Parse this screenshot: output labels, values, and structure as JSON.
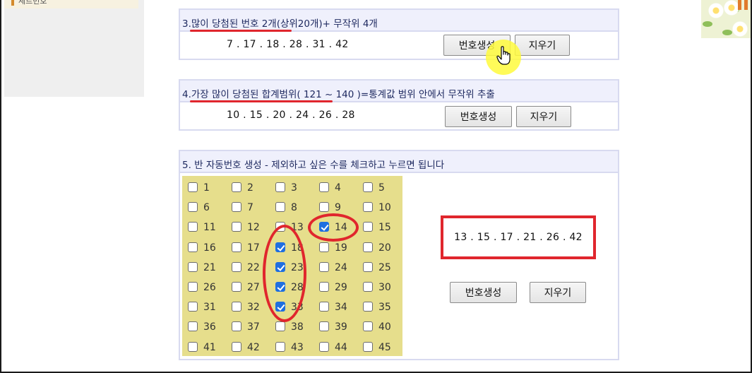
{
  "left_panel": {
    "text": "세트번호"
  },
  "sections": [
    {
      "title": "3.많이 당첨된 번호 2개(상위20개)+ 무작위 4개",
      "numbers": "7 . 17 . 18 . 28 . 31 . 42",
      "generate_label": "번호생성",
      "clear_label": "지우기"
    },
    {
      "title": "4.가장 많이 당첨된 합계범위( 121 ~ 140 )=통계값 범위 안에서 무작위 추출",
      "numbers": "10 . 15 . 20 . 24 . 26 . 28",
      "generate_label": "번호생성",
      "clear_label": "지우기"
    },
    {
      "title": "5. 반 자동번호 생성 - 제외하고 싶은 수를 체크하고 누르면 됩니다",
      "numbers": "13 . 15 . 17 . 21 . 26 . 42",
      "generate_label": "번호생성",
      "clear_label": "지우기"
    }
  ],
  "grid": {
    "numbers": [
      1,
      2,
      3,
      4,
      5,
      6,
      7,
      8,
      9,
      10,
      11,
      12,
      13,
      14,
      15,
      16,
      17,
      18,
      19,
      20,
      21,
      22,
      23,
      24,
      25,
      26,
      27,
      28,
      29,
      30,
      31,
      32,
      33,
      34,
      35,
      36,
      37,
      38,
      39,
      40,
      41,
      42,
      43,
      44,
      45
    ],
    "checked": [
      14,
      18,
      23,
      28,
      33
    ]
  },
  "colors": {
    "accent_red": "#e0262d",
    "header_bg": "#eff0fc",
    "header_border": "#d8daf0",
    "grid_bg": "#e6de8c",
    "checkbox_checked": "#1f6fe0",
    "cursor_highlight": "#fff83c"
  }
}
